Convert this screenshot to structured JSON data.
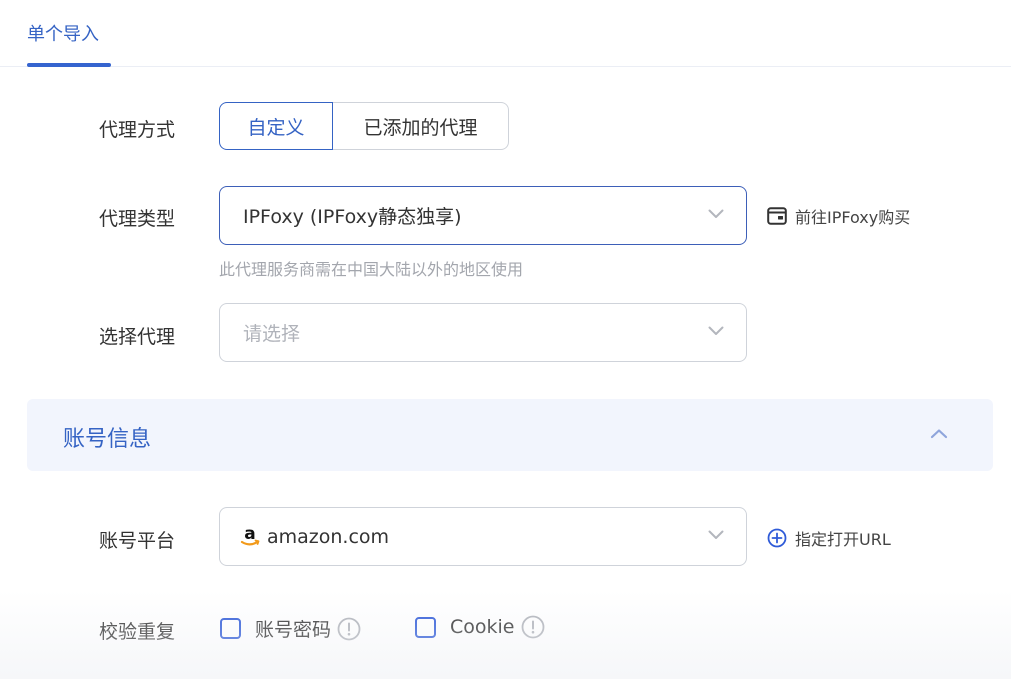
{
  "tabs": {
    "active_label": "单个导入"
  },
  "proxy_mode": {
    "label": "代理方式",
    "options": [
      "自定义",
      "已添加的代理"
    ],
    "selected": "自定义"
  },
  "proxy_type": {
    "label": "代理类型",
    "value": "IPFoxy (IPFoxy静态独享)",
    "hint": "此代理服务商需在中国大陆以外的地区使用",
    "link_label": "前往IPFoxy购买"
  },
  "select_proxy": {
    "label": "选择代理",
    "placeholder": "请选择"
  },
  "account_section": {
    "title": "账号信息"
  },
  "account_platform": {
    "label": "账号平台",
    "value": "amazon.com",
    "link_label": "指定打开URL"
  },
  "verify_duplicate": {
    "label": "校验重复",
    "options": [
      {
        "label": "账号密码",
        "checked": false
      },
      {
        "label": "Cookie",
        "checked": false
      }
    ]
  },
  "colors": {
    "accent": "#3563c4",
    "section_bg": "#f2f5fd",
    "border": "#cfd3da"
  },
  "icons": {
    "dropdown": "chevron-down-icon",
    "collapse": "chevron-up-icon",
    "external": "browser-window-icon",
    "add": "plus-circle-icon",
    "info": "exclamation-circle-icon",
    "platform": "amazon-logo-icon"
  }
}
